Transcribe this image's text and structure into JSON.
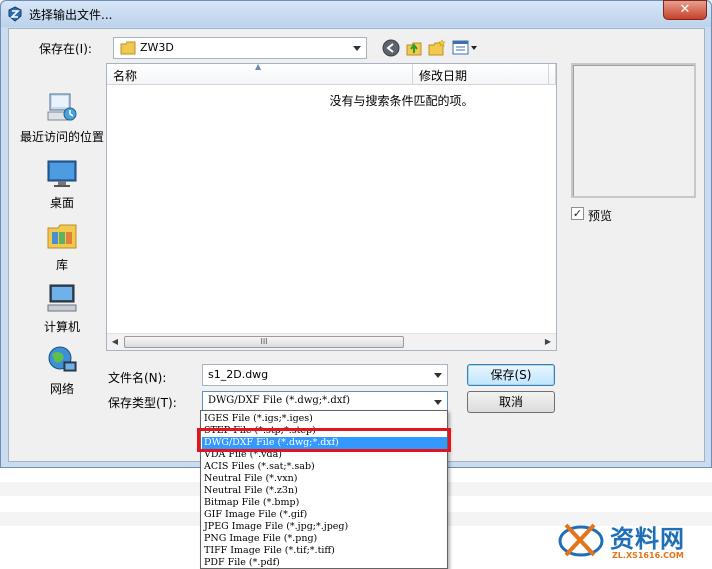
{
  "window": {
    "title": "选择输出文件...",
    "close_label": "✕"
  },
  "save_in": {
    "label": "保存在(I):",
    "value": "ZW3D"
  },
  "places": [
    {
      "name": "最近访问的位置",
      "icon": "recent-places-icon"
    },
    {
      "name": "桌面",
      "icon": "desktop-icon"
    },
    {
      "name": "库",
      "icon": "library-icon"
    },
    {
      "name": "计算机",
      "icon": "computer-icon"
    },
    {
      "name": "网络",
      "icon": "network-icon"
    }
  ],
  "file_list": {
    "columns": [
      "名称",
      "修改日期"
    ],
    "empty_message": "没有与搜索条件匹配的项。",
    "scroll_grip": "III"
  },
  "preview": {
    "label": "预览",
    "checked": true,
    "check_mark": "✓"
  },
  "file_name": {
    "label": "文件名(N):",
    "value": "s1_2D.dwg"
  },
  "save_type": {
    "label": "保存类型(T):",
    "value": "DWG/DXF File (*.dwg;*.dxf)",
    "options": [
      "IGES File (*.igs;*.iges)",
      "STEP File (*.stp;*.step)",
      "DWG/DXF File (*.dwg;*.dxf)",
      "VDA File (*.vda)",
      "ACIS Files (*.sat;*.sab)",
      "Neutral File (*.vxn)",
      "Neutral File (*.z3n)",
      "Bitmap File (*.bmp)",
      "GIF Image File (*.gif)",
      "JPEG Image File (*.jpg;*.jpeg)",
      "PNG Image File (*.png)",
      "TIFF Image File (*.tif;*.tiff)",
      "PDF File (*.pdf)"
    ],
    "selected_index": 2
  },
  "buttons": {
    "save": "保存(S)",
    "cancel": "取消"
  },
  "watermark": {
    "brand": "资料网",
    "url": "ZL.XS1616.COM"
  },
  "colors": {
    "selection": "#3399ff",
    "highlight_box": "#e3141e",
    "close_button": "#c7412a"
  }
}
